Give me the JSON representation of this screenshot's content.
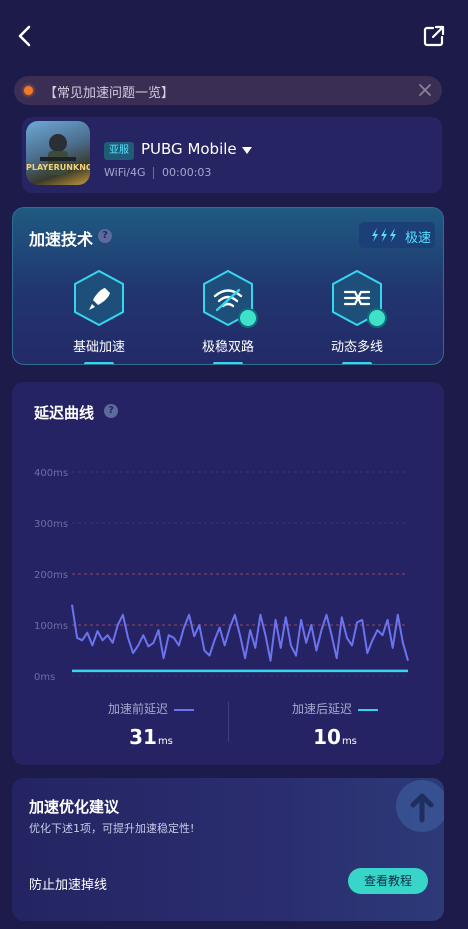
{
  "notice": {
    "text": "【常见加速问题一览】"
  },
  "game": {
    "icon_text": "PLAYERUNKNOWN'S",
    "region": "亚服",
    "name": "PUBG Mobile",
    "network": "WiFi/4G",
    "elapsed": "00:00:03"
  },
  "tech": {
    "title": "加速技术",
    "mode": "极速",
    "items": [
      {
        "label": "基础加速",
        "icon": "rocket-icon"
      },
      {
        "label": "极稳双路",
        "icon": "wifi-dual-icon"
      },
      {
        "label": "动态多线",
        "icon": "multi-route-icon"
      }
    ]
  },
  "latency": {
    "title": "延迟曲线",
    "before_label": "加速前延迟",
    "before_value": "31",
    "after_label": "加速后延迟",
    "after_value": "10",
    "unit": "ms"
  },
  "chart_data": {
    "type": "line",
    "y_ticks": [
      "400ms",
      "300ms",
      "200ms",
      "100ms",
      "0ms"
    ],
    "ylim": [
      0,
      400
    ],
    "threshold_lines": [
      100,
      200
    ],
    "series": [
      {
        "name": "加速前延迟",
        "color": "#6c73ee",
        "values": [
          140,
          75,
          70,
          85,
          60,
          88,
          70,
          80,
          65,
          100,
          120,
          75,
          45,
          60,
          80,
          58,
          65,
          90,
          35,
          80,
          75,
          60,
          95,
          120,
          78,
          100,
          50,
          40,
          70,
          95,
          60,
          95,
          120,
          80,
          35,
          90,
          55,
          120,
          80,
          30,
          110,
          55,
          115,
          60,
          40,
          110,
          65,
          100,
          50,
          90,
          120,
          80,
          35,
          115,
          75,
          60,
          105,
          110,
          45,
          70,
          90,
          80,
          110,
          55,
          120,
          65,
          30
        ]
      },
      {
        "name": "加速后延迟",
        "color": "#37d6f0",
        "values": [
          10,
          10,
          10,
          10,
          10,
          10,
          10,
          10,
          10,
          10,
          10,
          10,
          10,
          10,
          10,
          10,
          10,
          10,
          10,
          10,
          10,
          10,
          10,
          10,
          10,
          10,
          10,
          10,
          10,
          10,
          10,
          10,
          10,
          10,
          10,
          10,
          10,
          10,
          10,
          10,
          10,
          10,
          10,
          10,
          10,
          10,
          10,
          10,
          10,
          10,
          10,
          10,
          10,
          10,
          10,
          10,
          10,
          10,
          10,
          10,
          10,
          10,
          10,
          10,
          10,
          10,
          10
        ]
      }
    ]
  },
  "suggest": {
    "title": "加速优化建议",
    "subtitle": "优化下述1项，可提升加速稳定性!",
    "item_label": "防止加速掉线",
    "button_label": "查看教程"
  },
  "colors": {
    "accent": "#37d6f0",
    "background": "#1c1b4a",
    "notice_dot": "#f07a2a"
  }
}
